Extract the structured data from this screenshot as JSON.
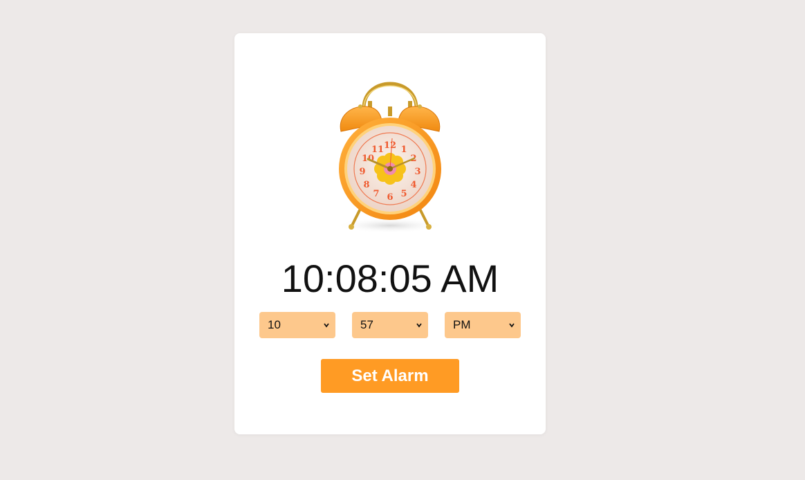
{
  "clock_image": {
    "icon": "alarm-clock-icon",
    "case_color": "#ff9a1e",
    "face_color": "#f7e6dc",
    "numeral_color": "#ef5a2f",
    "flower_color": "#f7c21a",
    "metal_color": "#d8b040",
    "dial_numerals": [
      "12",
      "1",
      "2",
      "3",
      "4",
      "5",
      "6",
      "7",
      "8",
      "9",
      "10",
      "11"
    ]
  },
  "current_time": "10:08:05 AM",
  "alarm": {
    "hour": "10",
    "minute": "57",
    "ampm": "PM"
  },
  "set_alarm_label": "Set Alarm",
  "colors": {
    "background": "#ede9e8",
    "card": "#ffffff",
    "select_bg": "#fdc88c",
    "button": "#ff9b24"
  }
}
